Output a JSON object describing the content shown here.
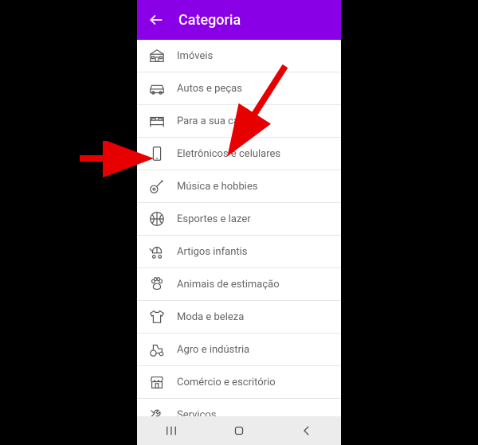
{
  "header": {
    "title": "Categoria"
  },
  "categories": [
    {
      "id": "imoveis",
      "label": "Imóveis"
    },
    {
      "id": "autos",
      "label": "Autos e peças"
    },
    {
      "id": "casa",
      "label": "Para a sua casa"
    },
    {
      "id": "eletronicos",
      "label": "Eletrônicos e celulares"
    },
    {
      "id": "musica",
      "label": "Música e hobbies"
    },
    {
      "id": "esportes",
      "label": "Esportes e lazer"
    },
    {
      "id": "infantis",
      "label": "Artigos infantis"
    },
    {
      "id": "animais",
      "label": "Animais de estimação"
    },
    {
      "id": "moda",
      "label": "Moda e beleza"
    },
    {
      "id": "agro",
      "label": "Agro e indústria"
    },
    {
      "id": "comercio",
      "label": "Comércio e escritório"
    },
    {
      "id": "servicos",
      "label": "Serviços"
    }
  ]
}
